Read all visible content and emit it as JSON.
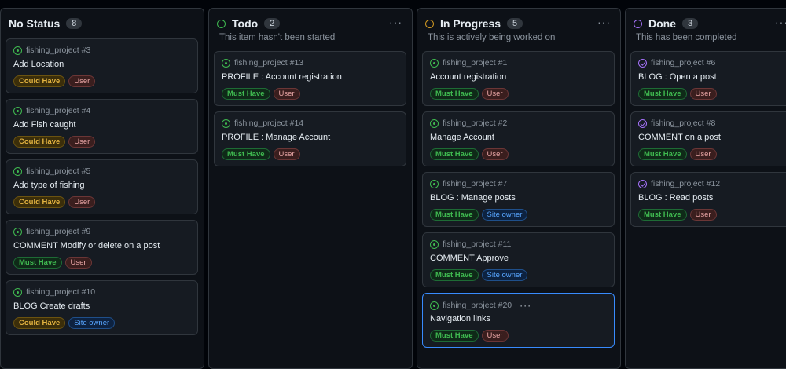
{
  "columns": [
    {
      "title": "No Status",
      "count": "8",
      "description": "",
      "ring_color": "",
      "cards": [
        {
          "meta": "fishing_project #3",
          "title": "Add Location",
          "labels": [
            {
              "text": "Could Have",
              "kind": "could"
            },
            {
              "text": "User",
              "kind": "user"
            }
          ]
        },
        {
          "meta": "fishing_project #4",
          "title": "Add Fish caught",
          "labels": [
            {
              "text": "Could Have",
              "kind": "could"
            },
            {
              "text": "User",
              "kind": "user"
            }
          ]
        },
        {
          "meta": "fishing_project #5",
          "title": "Add type of fishing",
          "labels": [
            {
              "text": "Could Have",
              "kind": "could"
            },
            {
              "text": "User",
              "kind": "user"
            }
          ]
        },
        {
          "meta": "fishing_project #9",
          "title": "COMMENT Modify or delete on a post",
          "labels": [
            {
              "text": "Must Have",
              "kind": "must"
            },
            {
              "text": "User",
              "kind": "user"
            }
          ]
        },
        {
          "meta": "fishing_project #10",
          "title": "BLOG Create drafts",
          "labels": [
            {
              "text": "Could Have",
              "kind": "could"
            },
            {
              "text": "Site owner",
              "kind": "site"
            }
          ]
        }
      ]
    },
    {
      "title": "Todo",
      "count": "2",
      "description": "This item hasn't been started",
      "ring_color": "#3fb950",
      "cards": [
        {
          "meta": "fishing_project #13",
          "title": "PROFILE : Account registration",
          "labels": [
            {
              "text": "Must Have",
              "kind": "must"
            },
            {
              "text": "User",
              "kind": "user"
            }
          ]
        },
        {
          "meta": "fishing_project #14",
          "title": "PROFILE : Manage Account",
          "labels": [
            {
              "text": "Must Have",
              "kind": "must"
            },
            {
              "text": "User",
              "kind": "user"
            }
          ]
        }
      ]
    },
    {
      "title": "In Progress",
      "count": "5",
      "description": "This is actively being worked on",
      "ring_color": "#d29922",
      "cards": [
        {
          "meta": "fishing_project #1",
          "title": "Account registration",
          "labels": [
            {
              "text": "Must Have",
              "kind": "must"
            },
            {
              "text": "User",
              "kind": "user"
            }
          ]
        },
        {
          "meta": "fishing_project #2",
          "title": "Manage Account",
          "labels": [
            {
              "text": "Must Have",
              "kind": "must"
            },
            {
              "text": "User",
              "kind": "user"
            }
          ]
        },
        {
          "meta": "fishing_project #7",
          "title": "BLOG : Manage posts",
          "labels": [
            {
              "text": "Must Have",
              "kind": "must"
            },
            {
              "text": "Site owner",
              "kind": "site"
            }
          ]
        },
        {
          "meta": "fishing_project #11",
          "title": "COMMENT Approve",
          "labels": [
            {
              "text": "Must Have",
              "kind": "must"
            },
            {
              "text": "Site owner",
              "kind": "site"
            }
          ]
        },
        {
          "meta": "fishing_project #20",
          "title": "Navigation links",
          "selected": true,
          "labels": [
            {
              "text": "Must Have",
              "kind": "must"
            },
            {
              "text": "User",
              "kind": "user"
            }
          ]
        }
      ]
    },
    {
      "title": "Done",
      "count": "3",
      "description": "This has been completed",
      "ring_color": "#a371f7",
      "cards": [
        {
          "meta": "fishing_project #6",
          "title": "BLOG : Open a post",
          "done": true,
          "labels": [
            {
              "text": "Must Have",
              "kind": "must"
            },
            {
              "text": "User",
              "kind": "user"
            }
          ]
        },
        {
          "meta": "fishing_project #8",
          "title": "COMMENT on a post",
          "done": true,
          "labels": [
            {
              "text": "Must Have",
              "kind": "must"
            },
            {
              "text": "User",
              "kind": "user"
            }
          ]
        },
        {
          "meta": "fishing_project #12",
          "title": "BLOG : Read posts",
          "done": true,
          "labels": [
            {
              "text": "Must Have",
              "kind": "must"
            },
            {
              "text": "User",
              "kind": "user"
            }
          ]
        }
      ]
    }
  ],
  "icons": {
    "column_menu": "more-horizontal-icon",
    "issue": "issue-open-icon",
    "closed_issue": "issue-closed-icon"
  }
}
